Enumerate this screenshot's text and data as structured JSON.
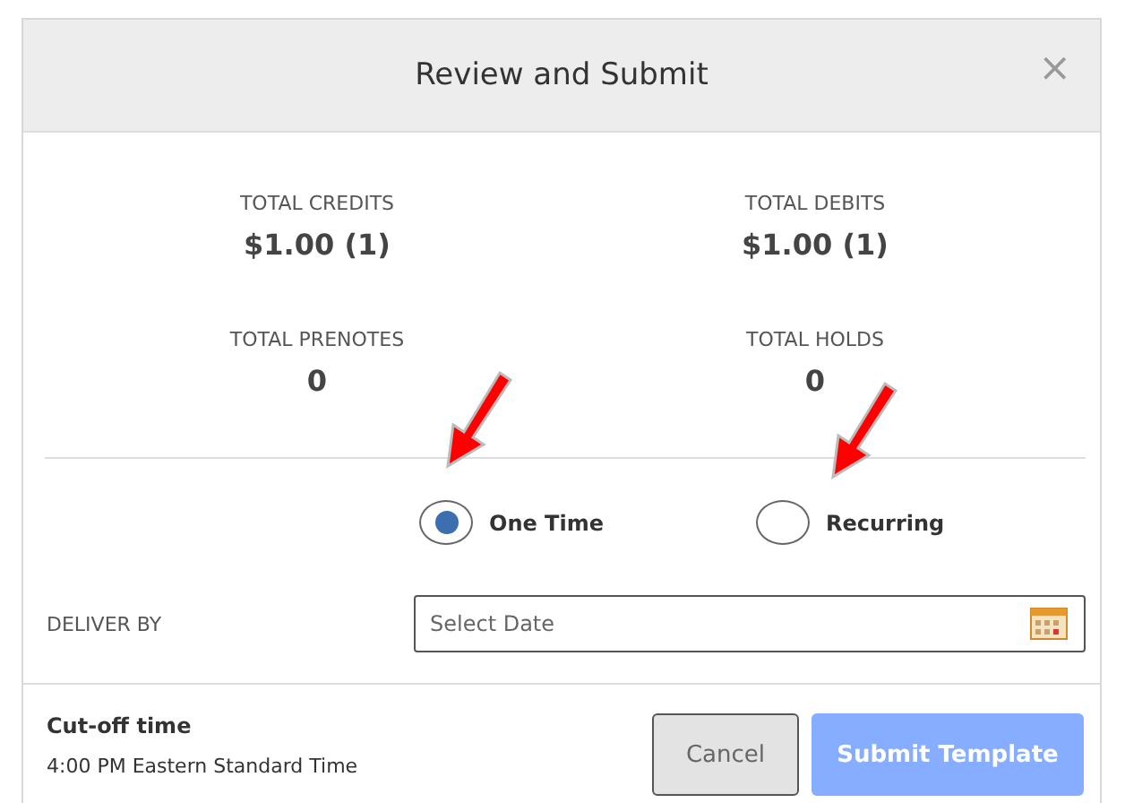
{
  "dialog": {
    "title": "Review and Submit",
    "close": "×"
  },
  "totals": [
    {
      "label": "TOTAL CREDITS",
      "value": "$1.00 (1)"
    },
    {
      "label": "TOTAL DEBITS",
      "value": "$1.00 (1)"
    },
    {
      "label": "TOTAL PRENOTES",
      "value": "0"
    },
    {
      "label": "TOTAL HOLDS",
      "value": "0"
    }
  ],
  "frequency": [
    {
      "label": "One Time",
      "selected": true
    },
    {
      "label": "Recurring",
      "selected": false
    }
  ],
  "deliver_by": {
    "label": "DELIVER BY",
    "placeholder": "Select Date"
  },
  "cutoff": {
    "title": "Cut-off time",
    "time": "4:00 PM",
    "zone": "Eastern Standard Time"
  },
  "buttons": [
    {
      "label": "Cancel",
      "kind": "secondary",
      "disabled": false
    },
    {
      "label": "Submit Template",
      "kind": "primary",
      "disabled": true
    }
  ]
}
